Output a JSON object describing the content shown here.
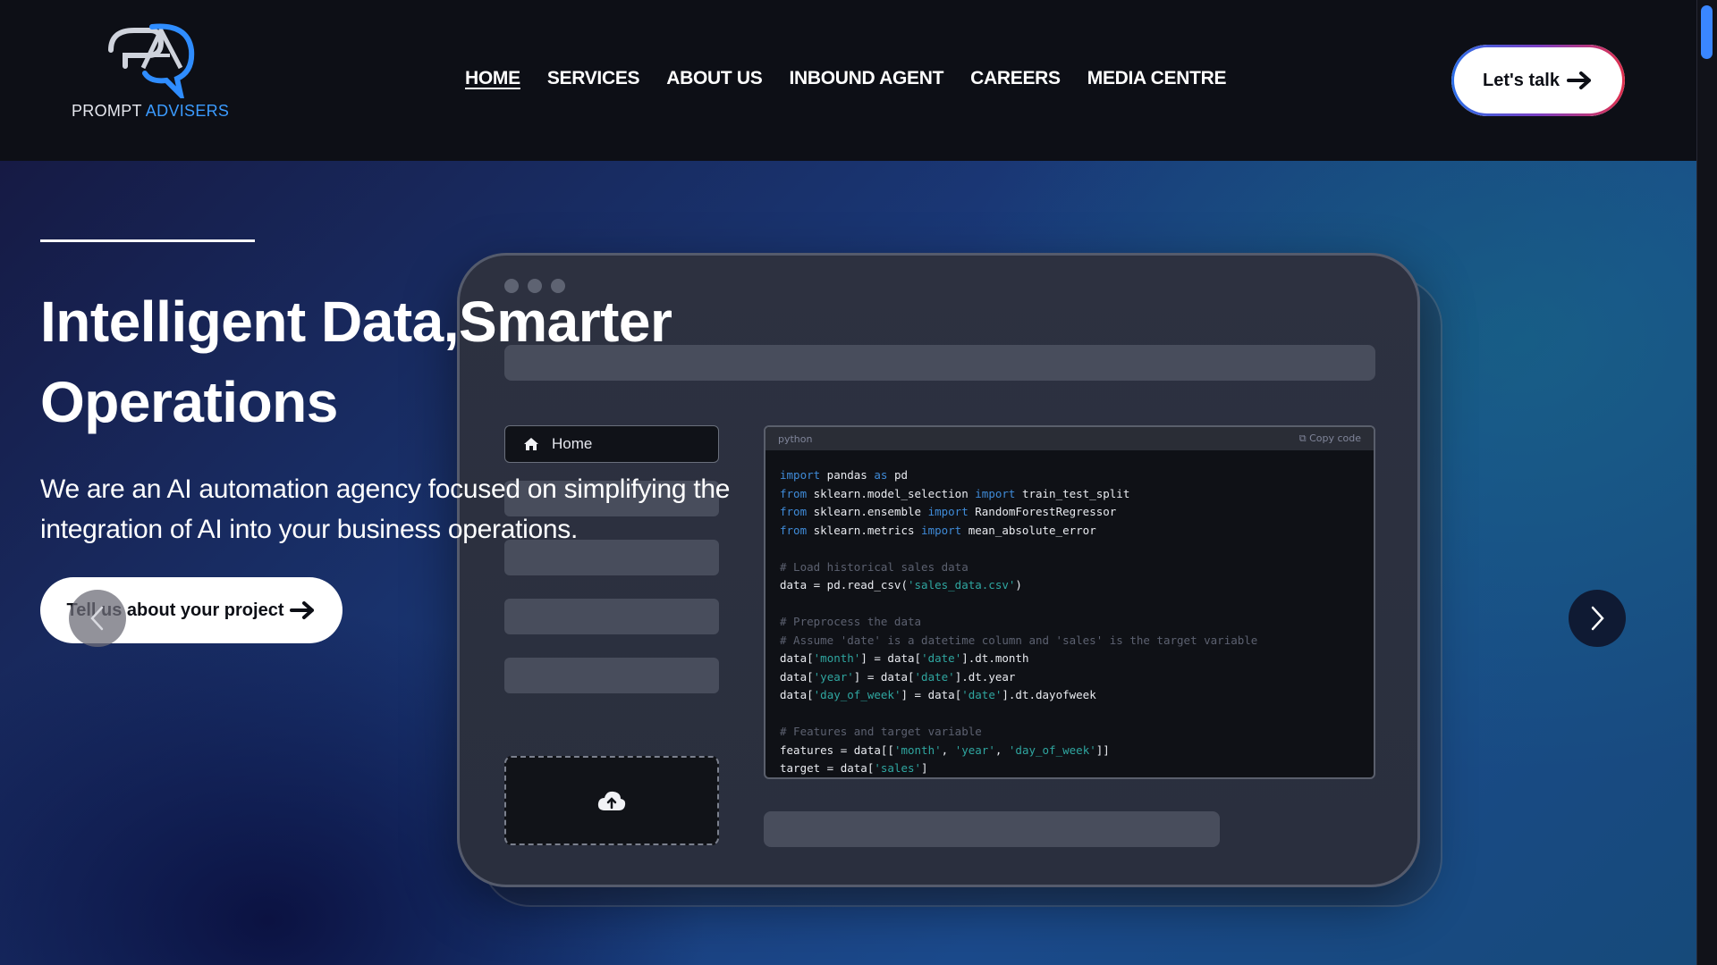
{
  "brand": {
    "name_part1": "PROMPT",
    "name_part2": "ADVISERS",
    "primary_color": "#3b9bff"
  },
  "nav": {
    "items": [
      {
        "label": "HOME",
        "active": true
      },
      {
        "label": "SERVICES",
        "active": false
      },
      {
        "label": "ABOUT US",
        "active": false
      },
      {
        "label": "INBOUND AGENT",
        "active": false
      },
      {
        "label": "CAREERS",
        "active": false
      },
      {
        "label": "MEDIA CENTRE",
        "active": false
      }
    ],
    "cta_label": "Let's talk"
  },
  "hero": {
    "title": "Intelligent Data,Smarter Operations",
    "subtitle": "We are an AI automation agency focused on simplifying the integration of AI into your business operations.",
    "cta_label": "Tell us about your project",
    "prev_icon": "chevron-left-icon",
    "next_icon": "chevron-right-icon"
  },
  "mockup": {
    "sidebar_home_label": "Home",
    "code_language": "python",
    "copy_label": "Copy code",
    "upload_icon": "cloud-upload-icon"
  },
  "colors": {
    "header_bg": "#0d0f16",
    "accent_blue": "#3b9bff",
    "cta_border_start": "#2b6ee8",
    "cta_border_end": "#e0304d"
  }
}
